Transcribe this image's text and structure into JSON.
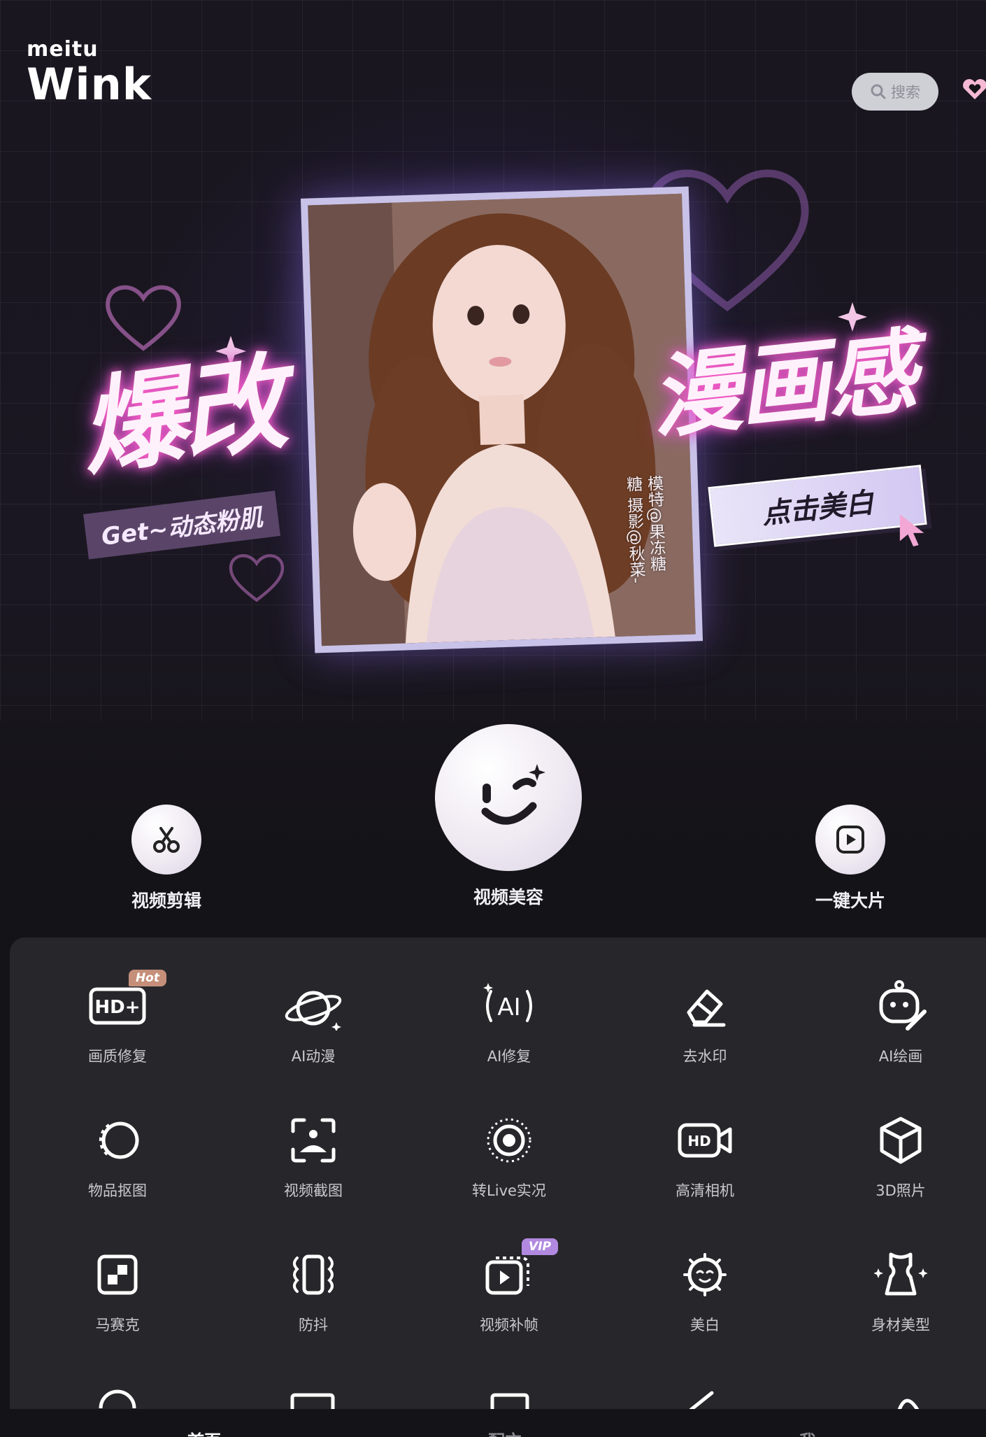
{
  "header": {
    "brand_small": "meitu",
    "brand_big": "Wink",
    "search_label": "搜索",
    "search_icon": "search-icon",
    "corner_icon": "heart-icon"
  },
  "banner": {
    "headline_left": "爆改",
    "headline_right": "漫画感",
    "tag_left": "Get~动态粉肌",
    "cta": "点击美白",
    "credit": "模特@果冻糖糖 摄影@秋菜-"
  },
  "actions": [
    {
      "label": "视频剪辑",
      "icon": "scissors-icon"
    },
    {
      "label": "视频美容",
      "icon": "wink-face-icon"
    },
    {
      "label": "一键大片",
      "icon": "play-square-icon"
    }
  ],
  "tools": [
    {
      "label": "画质修复",
      "icon": "hd-plus-icon",
      "badge": "Hot"
    },
    {
      "label": "AI动漫",
      "icon": "planet-icon",
      "badge": ""
    },
    {
      "label": "AI修复",
      "icon": "ai-sparkle-icon",
      "badge": ""
    },
    {
      "label": "去水印",
      "icon": "eraser-icon",
      "badge": ""
    },
    {
      "label": "AI绘画",
      "icon": "robot-brush-icon",
      "badge": ""
    },
    {
      "label": "物品抠图",
      "icon": "cutout-circle-icon",
      "badge": ""
    },
    {
      "label": "视频截图",
      "icon": "frame-capture-icon",
      "badge": ""
    },
    {
      "label": "转Live实况",
      "icon": "live-photo-icon",
      "badge": ""
    },
    {
      "label": "高清相机",
      "icon": "hd-camera-icon",
      "badge": ""
    },
    {
      "label": "3D照片",
      "icon": "cube-icon",
      "badge": ""
    },
    {
      "label": "马赛克",
      "icon": "mosaic-icon",
      "badge": ""
    },
    {
      "label": "防抖",
      "icon": "stabilize-icon",
      "badge": ""
    },
    {
      "label": "视频补帧",
      "icon": "frame-interp-icon",
      "badge": "VIP"
    },
    {
      "label": "美白",
      "icon": "face-glow-icon",
      "badge": ""
    },
    {
      "label": "身材美型",
      "icon": "body-shape-icon",
      "badge": ""
    }
  ],
  "bottom_nav": [
    {
      "label": "首页",
      "active": true
    },
    {
      "label": "配方",
      "active": false
    },
    {
      "label": "我",
      "active": false
    }
  ]
}
